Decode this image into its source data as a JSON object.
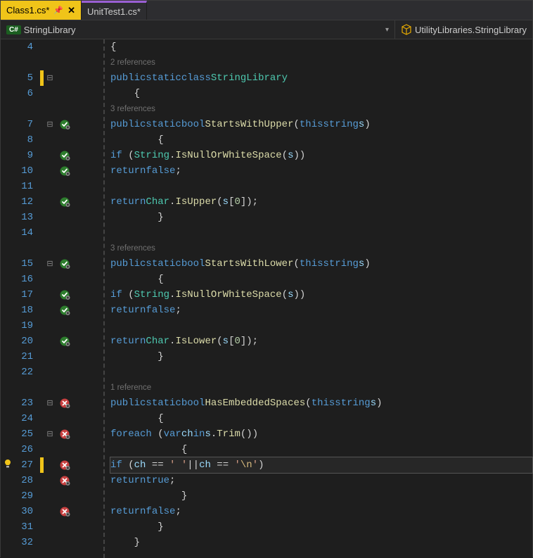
{
  "tabs": [
    {
      "label": "Class1.cs*",
      "active": true,
      "pinned": true
    },
    {
      "label": "UnitTest1.cs*",
      "active": false,
      "pinned": false
    }
  ],
  "navbar": {
    "left_icon": "C#",
    "left_label": "StringLibrary",
    "right_label": "UtilityLibraries.StringLibrary"
  },
  "references": {
    "class": "2 references",
    "upper": "3 references",
    "lower": "3 references",
    "embedded": "1 reference"
  },
  "code": {
    "l4": "{",
    "l5_public": "public",
    "l5_static": "static",
    "l5_class": "class",
    "l5_name": "StringLibrary",
    "l6": "{",
    "l7_public": "public",
    "l7_static": "static",
    "l7_bool": "bool",
    "l7_name": "StartsWithUpper",
    "l7_this": "this",
    "l7_string": "string",
    "l7_param": "s",
    "l8": "{",
    "l9_if": "if",
    "l9_type": "String",
    "l9_method": "IsNullOrWhiteSpace",
    "l9_param": "s",
    "l10_return": "return",
    "l10_false": "false",
    "l12_return": "return",
    "l12_type": "Char",
    "l12_method": "IsUpper",
    "l12_param": "s",
    "l12_idx": "0",
    "l13": "}",
    "l15_public": "public",
    "l15_static": "static",
    "l15_bool": "bool",
    "l15_name": "StartsWithLower",
    "l15_this": "this",
    "l15_string": "string",
    "l15_param": "s",
    "l16": "{",
    "l17_if": "if",
    "l17_type": "String",
    "l17_method": "IsNullOrWhiteSpace",
    "l17_param": "s",
    "l18_return": "return",
    "l18_false": "false",
    "l20_return": "return",
    "l20_type": "Char",
    "l20_method": "IsLower",
    "l20_param": "s",
    "l20_idx": "0",
    "l21": "}",
    "l23_public": "public",
    "l23_static": "static",
    "l23_bool": "bool",
    "l23_name": "HasEmbeddedSpaces",
    "l23_this": "this",
    "l23_string": "string",
    "l23_param": "s",
    "l24": "{",
    "l25_foreach": "foreach",
    "l25_var": "var",
    "l25_ch": "ch",
    "l25_in": "in",
    "l25_param": "s",
    "l25_method": "Trim",
    "l26": "{",
    "l27_if": "if",
    "l27_ch1": "ch",
    "l27_sp": "' '",
    "l27_or": "||",
    "l27_ch2": "ch",
    "l27_q1": "'",
    "l27_esc": "\\n",
    "l27_q2": "'",
    "l28_return": "return",
    "l28_true": "true",
    "l29": "}",
    "l30_return": "return",
    "l30_false": "false",
    "l31": "}",
    "l32": "}"
  },
  "linenos": {
    "4": "4",
    "5": "5",
    "6": "6",
    "7": "7",
    "8": "8",
    "9": "9",
    "10": "10",
    "11": "11",
    "12": "12",
    "13": "13",
    "14": "14",
    "15": "15",
    "16": "16",
    "17": "17",
    "18": "18",
    "19": "19",
    "20": "20",
    "21": "21",
    "22": "22",
    "23": "23",
    "24": "24",
    "25": "25",
    "26": "26",
    "27": "27",
    "28": "28",
    "29": "29",
    "30": "30",
    "31": "31",
    "32": "32"
  }
}
